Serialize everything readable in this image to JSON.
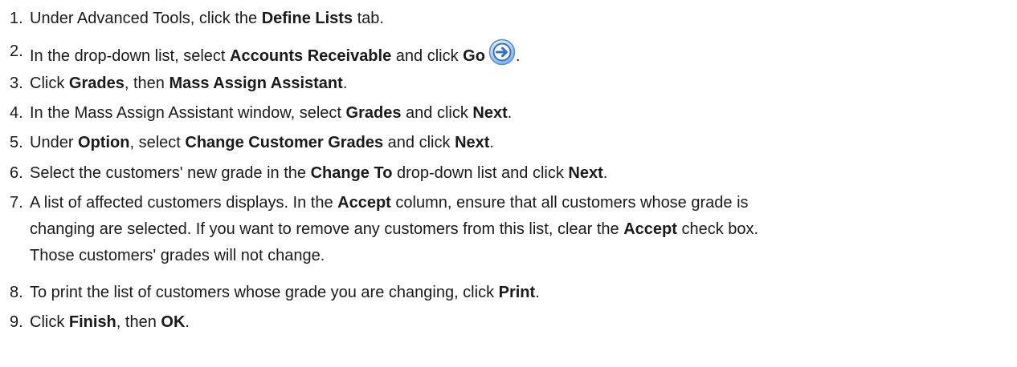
{
  "steps": [
    {
      "number": "1.",
      "parts": [
        "Under Advanced Tools, click the ",
        "Define Lists",
        " tab."
      ]
    },
    {
      "number": "2.",
      "parts": [
        "In the drop-down list, select ",
        "Accounts Receivable",
        " and click ",
        "Go",
        "."
      ],
      "icon": "go-arrow-icon"
    },
    {
      "number": "3.",
      "parts": [
        "Click ",
        "Grades",
        ", then ",
        "Mass Assign Assistant",
        "."
      ]
    },
    {
      "number": "4.",
      "parts": [
        "In the Mass Assign Assistant window, select ",
        "Grades",
        " and click ",
        "Next",
        "."
      ]
    },
    {
      "number": "5.",
      "parts": [
        "Under ",
        "Option",
        ", select ",
        "Change Customer Grades",
        " and click ",
        "Next",
        "."
      ]
    },
    {
      "number": "6.",
      "parts": [
        "Select the customers' new grade in the ",
        "Change To",
        " drop-down list and click ",
        "Next",
        "."
      ]
    },
    {
      "number": "7.",
      "line1": [
        "A list of affected customers displays. In the ",
        "Accept",
        " column, ensure that all customers whose grade is"
      ],
      "line2": [
        "changing are selected. If you want to remove any customers from this list, clear the ",
        "Accept",
        " check box."
      ],
      "line3": [
        "Those customers' grades will not change."
      ]
    },
    {
      "number": "8.",
      "parts": [
        "To print the list of customers whose grade you are changing, click ",
        "Print",
        "."
      ]
    },
    {
      "number": "9.",
      "parts": [
        "Click ",
        "Finish",
        ", then ",
        "OK",
        "."
      ]
    }
  ],
  "colors": {
    "text": "#1a1a1a",
    "icon_blue": "#2f6fd6",
    "icon_light": "#cfe4fb"
  }
}
